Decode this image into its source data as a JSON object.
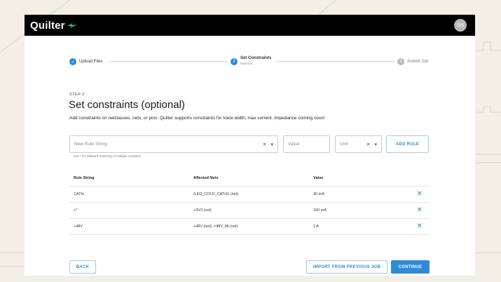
{
  "app": {
    "brand": "Quilter",
    "user_initials": "SN"
  },
  "stepper": [
    {
      "label": "Upload Files",
      "sub": "",
      "state": "done",
      "number": ""
    },
    {
      "label": "Set Constraints",
      "sub": "Optional",
      "state": "active",
      "number": "2"
    },
    {
      "label": "Submit Job",
      "sub": "",
      "state": "pending",
      "number": "3"
    }
  ],
  "page": {
    "step_tag": "STEP 2",
    "title": "Set constraints (optional)",
    "description": "Add constraints on netclasses, nets, or pins. Quilter supports constraints for trace width, max current. Impedance coming soon!"
  },
  "form": {
    "rule_placeholder": "New Rule String",
    "value_placeholder": "Value",
    "unit_placeholder": "Unit",
    "add_label": "ADD RULE",
    "hint": "Use * for wildcard matching of multiple nets/pins"
  },
  "table": {
    "headers": [
      "Rule String",
      "Affected Nets",
      "Value"
    ],
    "rows": [
      {
        "rule": "CATH",
        "nets": "/LED_COLD_CATH1 (net)",
        "value": "30 mA"
      },
      {
        "rule": "+*",
        "nets": "+3V3 (net)",
        "value": "100 mA"
      },
      {
        "rule": "+48V",
        "nets": "+48V (net); +48V_filt (net)",
        "value": "1 A"
      }
    ]
  },
  "actions": {
    "back": "BACK",
    "import": "IMPORT FROM PREVIOUS JOB",
    "continue": "CONTINUE"
  },
  "colors": {
    "accent": "#2f8ad8",
    "brand_mark": "#2ecc71",
    "topbar": "#000000",
    "background": "#f1efe6"
  }
}
